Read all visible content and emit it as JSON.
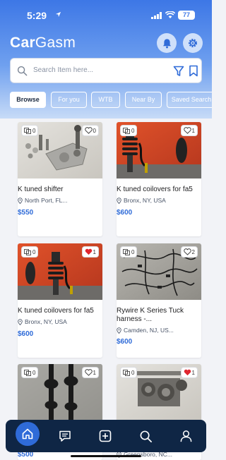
{
  "status_bar": {
    "time": "5:29",
    "battery": "77"
  },
  "brand": {
    "name_bold": "Car",
    "name_regular": "Gasm"
  },
  "search": {
    "placeholder": "Search Item here..."
  },
  "chips": [
    "Browse",
    "For you",
    "WTB",
    "Near By",
    "Saved Search"
  ],
  "listings": [
    {
      "title": "K tuned shifter",
      "location": "North Port, FL...",
      "price": "$550",
      "views": "0",
      "likes": "0",
      "liked": false,
      "photo": "shifter"
    },
    {
      "title": "K tuned coilovers for fa5",
      "location": "Bronx, NY, USA",
      "price": "$600",
      "views": "0",
      "likes": "1",
      "liked": false,
      "photo": "coilover"
    },
    {
      "title": "K tuned coilovers for fa5",
      "location": "Bronx, NY, USA",
      "price": "$600",
      "views": "0",
      "likes": "1",
      "liked": true,
      "photo": "coilover"
    },
    {
      "title": "Rywire K Series Tuck",
      "title_line2": "harness -...",
      "location": "Camden, NJ, US...",
      "price": "$600",
      "views": "0",
      "likes": "2",
      "liked": false,
      "photo": "harness"
    },
    {
      "title": "",
      "location": "",
      "price": "$500",
      "views": "0",
      "likes": "1",
      "liked": false,
      "photo": "axles"
    },
    {
      "title": "",
      "location": "Greensboro, NC...",
      "price": "",
      "views": "0",
      "likes": "1",
      "liked": true,
      "photo": "gears"
    }
  ],
  "colors": {
    "brand_blue": "#2f6bd8",
    "nav_bg": "#0f2645",
    "heart_red": "#e0262f"
  }
}
